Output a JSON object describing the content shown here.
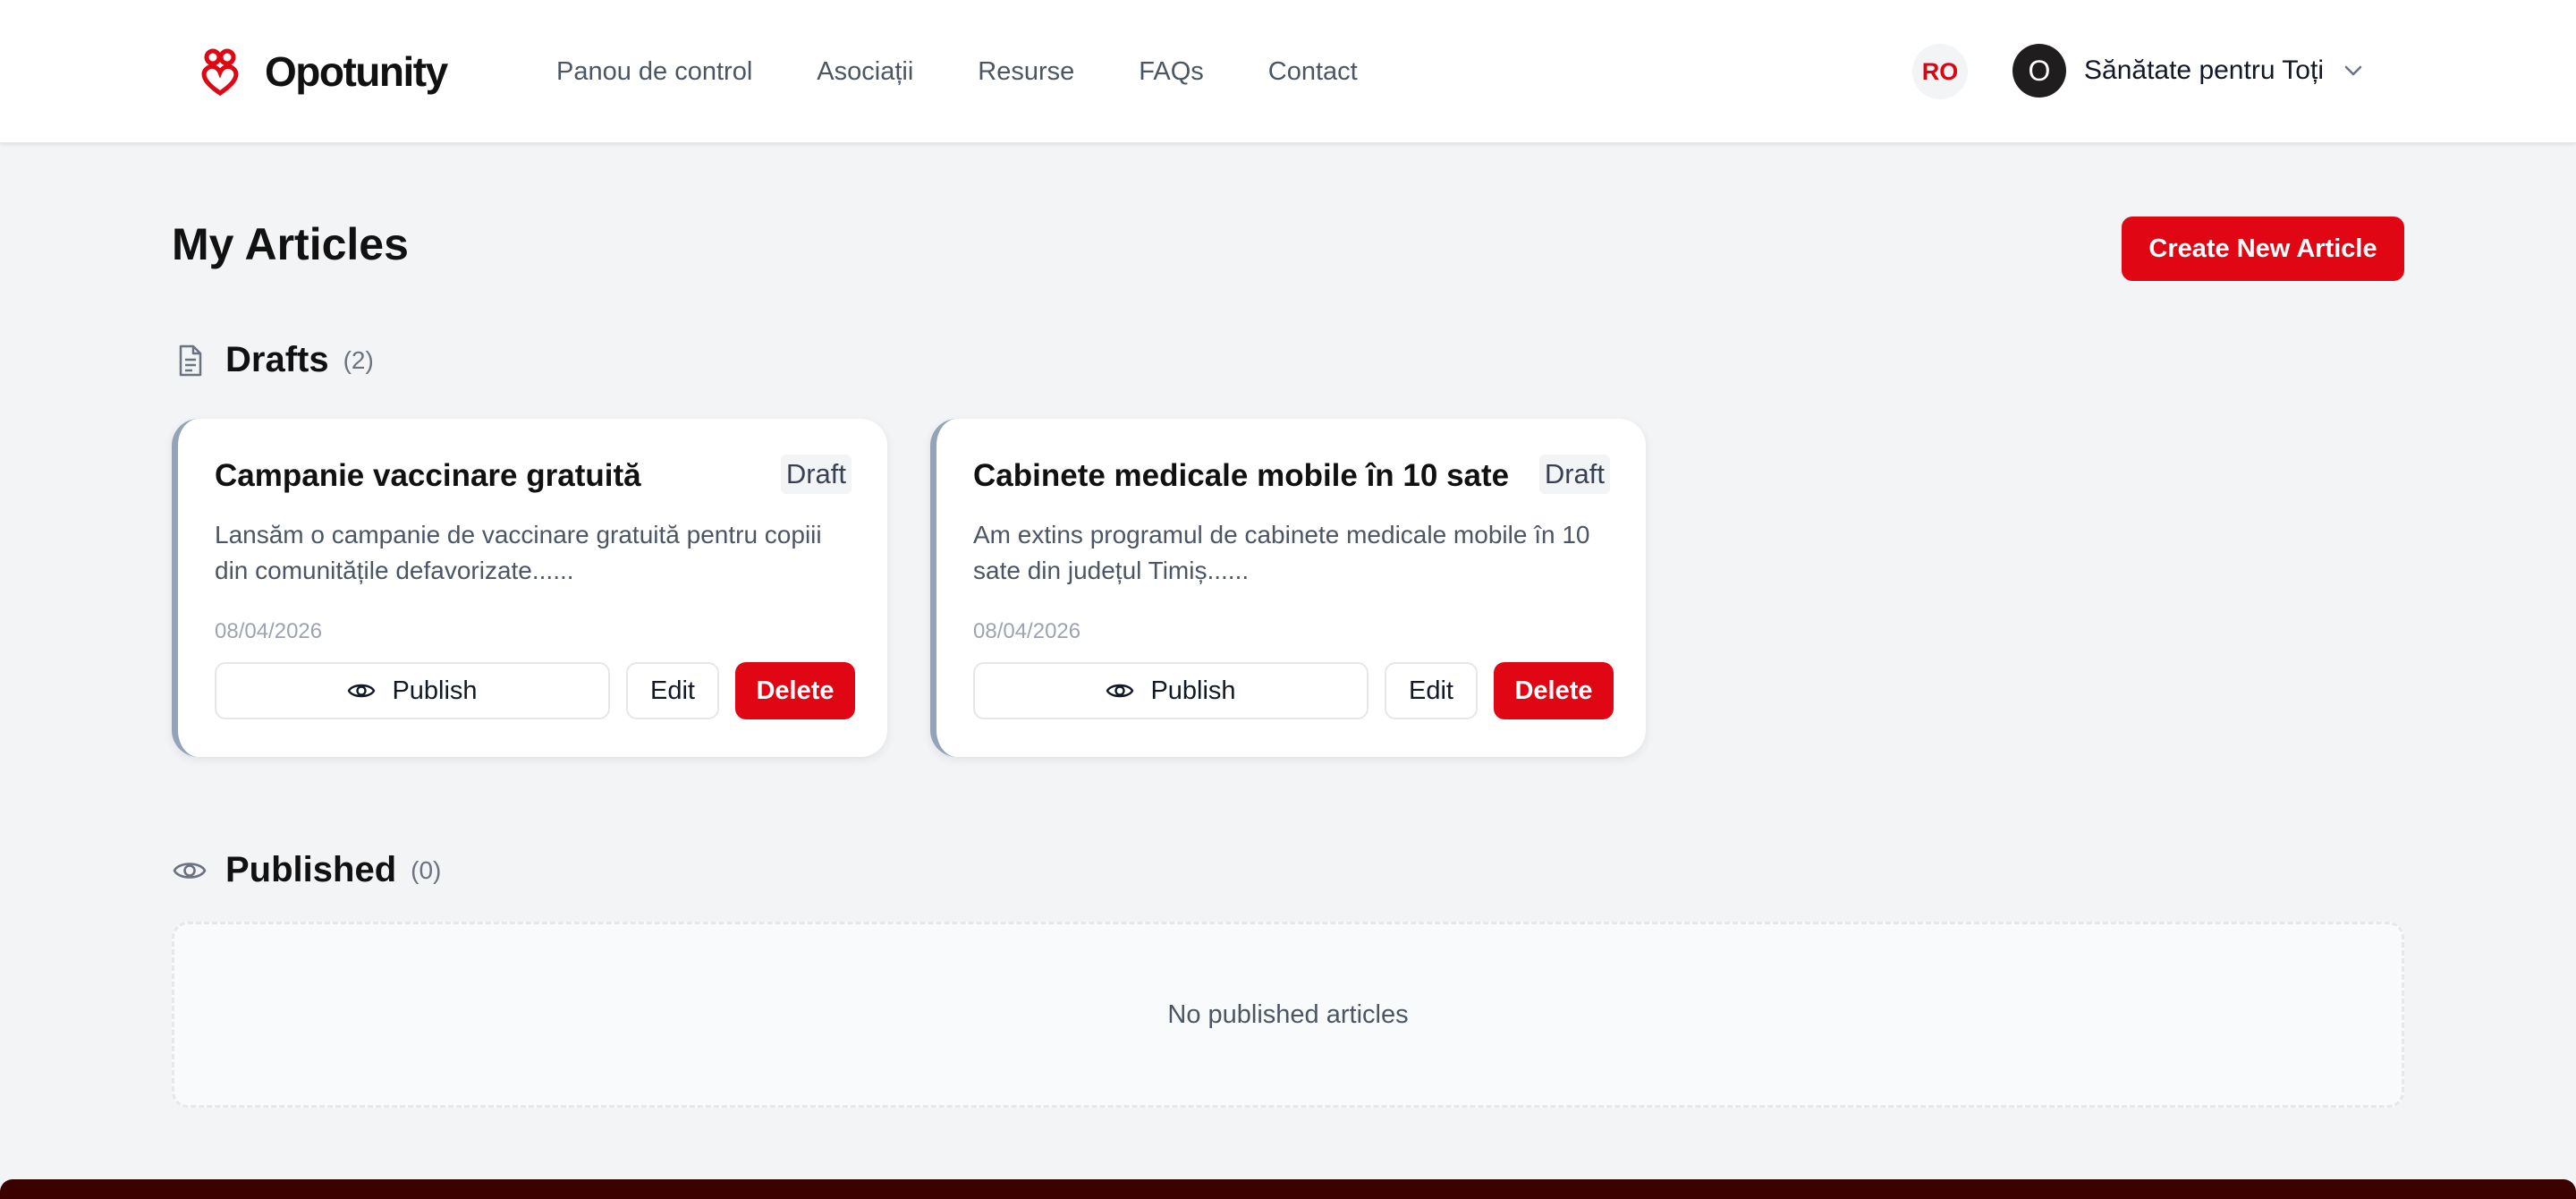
{
  "brand": {
    "name": "Opotunity",
    "accent_color": "#e10613"
  },
  "nav": [
    {
      "label": "Panou de control"
    },
    {
      "label": "Asociații"
    },
    {
      "label": "Resurse"
    },
    {
      "label": "FAQs"
    },
    {
      "label": "Contact"
    }
  ],
  "header": {
    "language": "RO",
    "user": {
      "initial": "O",
      "name": "Sănătate pentru Toți"
    }
  },
  "main": {
    "title": "My Articles",
    "create_button": "Create New Article"
  },
  "drafts": {
    "title": "Drafts",
    "count": "(2)",
    "cards": [
      {
        "title": "Campanie vaccinare gratuită",
        "status": "Draft",
        "excerpt": "Lansăm o campanie de vaccinare gratuită pentru copiii din comunitățile defavorizate......",
        "date": "08/04/2026",
        "publish_label": "Publish",
        "edit_label": "Edit",
        "delete_label": "Delete"
      },
      {
        "title": "Cabinete medicale mobile în 10 sate",
        "status": "Draft",
        "excerpt": "Am extins programul de cabinete medicale mobile în 10 sate din județul Timiș......",
        "date": "08/04/2026",
        "publish_label": "Publish",
        "edit_label": "Edit",
        "delete_label": "Delete"
      }
    ]
  },
  "published": {
    "title": "Published",
    "count": "(0)",
    "empty_text": "No published articles"
  }
}
